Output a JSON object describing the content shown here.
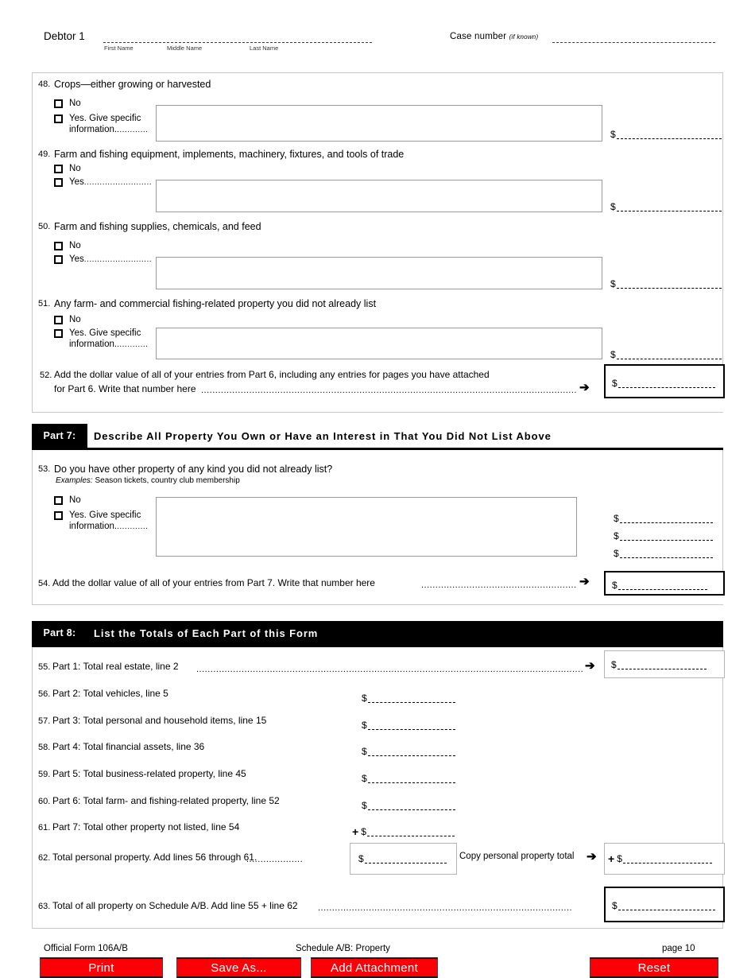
{
  "header": {
    "debtor_label": "Debtor 1",
    "first_name": "First Name",
    "middle_name": "Middle Name",
    "last_name": "Last Name",
    "case_label": "Case number",
    "case_italic": "(if known)"
  },
  "questions": [
    {
      "num": "48.",
      "text": "Crops—either growing or harvested",
      "no_label": "No",
      "yes_label": "Yes. Give specific",
      "yes_label2": "information.",
      "yes_dots": "............",
      "dollar_symbol": "$"
    },
    {
      "num": "49.",
      "text": "Farm and fishing equipment, implements, machinery, fixtures, and tools of trade",
      "no_label": "No",
      "yes_label": "Yes",
      "yes_dots": "..........................",
      "dollar_symbol": "$"
    },
    {
      "num": "50.",
      "text": "Farm and fishing supplies, chemicals, and feed",
      "no_label": "No",
      "yes_label": "Yes",
      "yes_dots": "..........................",
      "dollar_symbol": "$"
    },
    {
      "num": "51.",
      "text": "Any farm- and commercial fishing-related property you did not already list",
      "no_label": "No",
      "yes_label": "Yes. Give specific",
      "yes_label2": "information.",
      "yes_dots": "............",
      "dollar_symbol": "$"
    }
  ],
  "line52": {
    "num": "52.",
    "text_line1": "Add the dollar value of all of your entries from Part 6, including any entries for pages you have attached",
    "text_line2": "for Part 6. Write that number here",
    "leader": "......................................................................................................................................................",
    "arrow": "➔",
    "dollar_symbol": "$"
  },
  "part7": {
    "tag": "Part 7:",
    "title": "Describe All Property You Own or Have an Interest in That You Did Not List Above",
    "question": {
      "num": "53.",
      "text": "Do you have other property of any kind you did not already list?",
      "examples_label": "Examples:",
      "examples_text": " Season tickets, country club membership",
      "no_label": "No",
      "yes_label": "Yes. Give specific",
      "yes_label2": "information.",
      "yes_dots": "............",
      "dollar_symbols": [
        "$",
        "$",
        "$"
      ]
    },
    "line54": {
      "num": "54.",
      "text": "Add the dollar value of all of your entries from Part 7. Write that number here",
      "leader": "...............................................................",
      "arrow": "➔",
      "dollar_symbol": "$"
    }
  },
  "part8": {
    "tag": "Part 8:",
    "title": "List the Totals of Each Part of this Form",
    "rows": [
      {
        "num": "55.",
        "text": "Part 1: Total real estate, line 2",
        "leader": "......................................................................................................................................................",
        "arrow": "➔",
        "dollar_symbol": "$",
        "boxed": true
      },
      {
        "num": "56.",
        "text": "Part 2: Total vehicles, line 5",
        "dollar_symbol": "$"
      },
      {
        "num": "57.",
        "text": "Part 3: Total personal and household items, line 15",
        "dollar_symbol": "$"
      },
      {
        "num": "58.",
        "text": "Part 4: Total financial assets, line 36",
        "dollar_symbol": "$"
      },
      {
        "num": "59.",
        "text": "Part 5: Total business-related property, line 45",
        "dollar_symbol": "$"
      },
      {
        "num": "60.",
        "text": "Part 6: Total farm- and fishing-related property, line 52",
        "dollar_symbol": "$"
      },
      {
        "num": "61.",
        "text": "Part 7: Total other property not listed, line 54",
        "plus": "+",
        "dollar_symbol": "$"
      }
    ],
    "line62": {
      "num": "62.",
      "text": "Total personal property. Add lines 56 through 61.",
      "leader": "....................",
      "dollar_symbol": "$",
      "copy_label": "Copy personal property total",
      "arrow": "➔",
      "plus": "+",
      "dollar_symbol2": "$"
    },
    "line63": {
      "num": "63.",
      "text": "Total of all property on Schedule A/B. Add line 55 + line 62",
      "leader": "..............................................................................................",
      "dollar_symbol": "$"
    }
  },
  "footer": {
    "form_label": "Official Form 106A/B",
    "schedule_label": "Schedule A/B: Property",
    "page_label": "page 10",
    "buttons": [
      {
        "label": "Print"
      },
      {
        "label": "Save As..."
      },
      {
        "label": "Add Attachment"
      },
      {
        "label": "Reset"
      }
    ],
    "button_color": "#fb0007"
  }
}
